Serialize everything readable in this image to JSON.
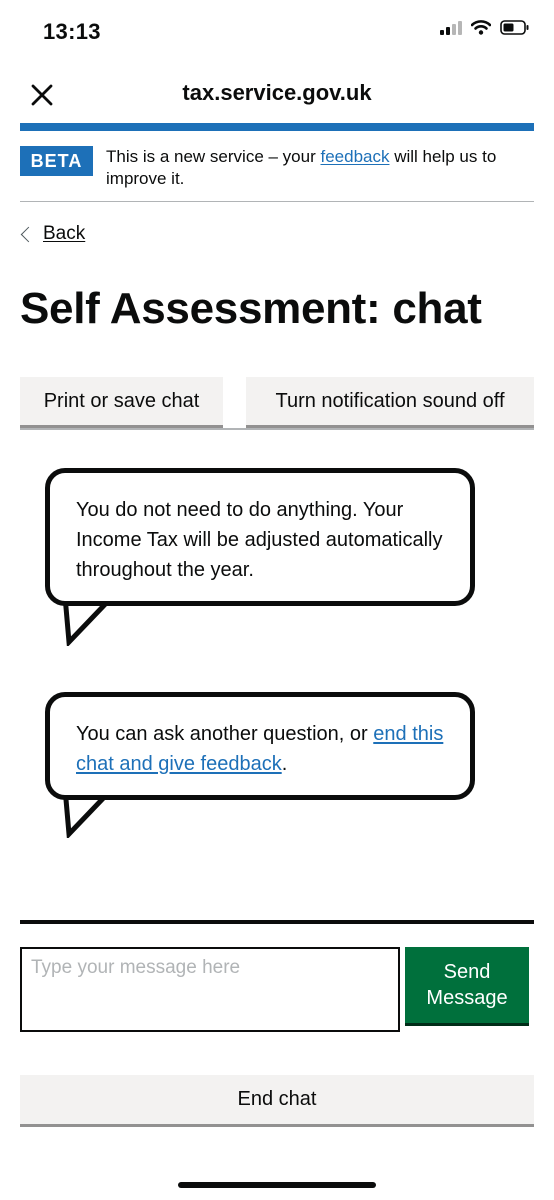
{
  "status_bar": {
    "time": "13:13"
  },
  "browser": {
    "url": "tax.service.gov.uk"
  },
  "banner": {
    "tag": "BETA",
    "text_before": "This is a new service – your",
    "link": "feedback",
    "text_after": "will help us to improve it."
  },
  "back_link": "Back",
  "page_title": "Self Assessment: chat",
  "toolbar": {
    "print_label": "Print or save chat",
    "sound_label": "Turn notification sound off"
  },
  "messages": [
    {
      "text": "You do not need to do anything. Your Income Tax will be adjusted automatically throughout the year."
    },
    {
      "text_before": "You can ask another question, or",
      "link": "end this chat and give feedback",
      "text_after": "."
    }
  ],
  "composer": {
    "placeholder": "Type your message here",
    "send_label": "Send Message"
  },
  "end_chat_label": "End chat",
  "colors": {
    "brand_blue": "#1d70b8",
    "button_green": "#00703c",
    "text": "#0b0c0c"
  }
}
